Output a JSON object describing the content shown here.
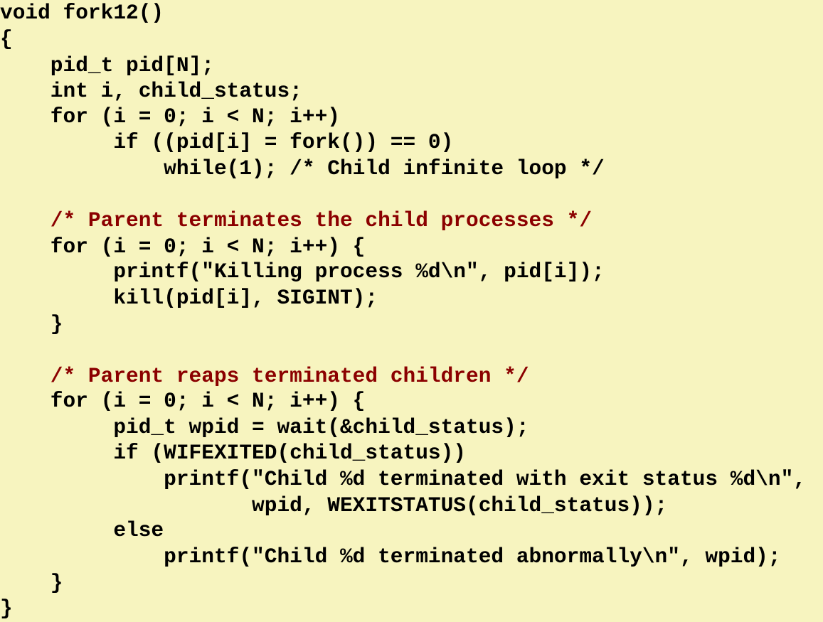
{
  "code": {
    "lines": [
      {
        "text": "void fork12()",
        "kind": "code"
      },
      {
        "text": "{",
        "kind": "code"
      },
      {
        "text": "    pid_t pid[N];",
        "kind": "code"
      },
      {
        "text": "    int i, child_status;",
        "kind": "code"
      },
      {
        "text": "    for (i = 0; i < N; i++)",
        "kind": "code"
      },
      {
        "text": "         if ((pid[i] = fork()) == 0)",
        "kind": "code"
      },
      {
        "text": "             while(1); /* Child infinite loop */",
        "kind": "code"
      },
      {
        "text": "",
        "kind": "code"
      },
      {
        "text": "    /* Parent terminates the child processes */",
        "kind": "comment"
      },
      {
        "text": "    for (i = 0; i < N; i++) {",
        "kind": "code"
      },
      {
        "text": "         printf(\"Killing process %d\\n\", pid[i]);",
        "kind": "code"
      },
      {
        "text": "         kill(pid[i], SIGINT);",
        "kind": "code"
      },
      {
        "text": "    }",
        "kind": "code"
      },
      {
        "text": "",
        "kind": "code"
      },
      {
        "text": "    /* Parent reaps terminated children */",
        "kind": "comment"
      },
      {
        "text": "    for (i = 0; i < N; i++) {",
        "kind": "code"
      },
      {
        "text": "         pid_t wpid = wait(&child_status);",
        "kind": "code"
      },
      {
        "text": "         if (WIFEXITED(child_status))",
        "kind": "code"
      },
      {
        "text": "             printf(\"Child %d terminated with exit status %d\\n\",",
        "kind": "code"
      },
      {
        "text": "                    wpid, WEXITSTATUS(child_status));",
        "kind": "code"
      },
      {
        "text": "         else",
        "kind": "code"
      },
      {
        "text": "             printf(\"Child %d terminated abnormally\\n\", wpid);",
        "kind": "code"
      },
      {
        "text": "    }",
        "kind": "code"
      },
      {
        "text": "}",
        "kind": "code"
      }
    ]
  },
  "colors": {
    "background": "#f7f4bf",
    "code_text": "#000000",
    "comment_text": "#8b0000"
  }
}
